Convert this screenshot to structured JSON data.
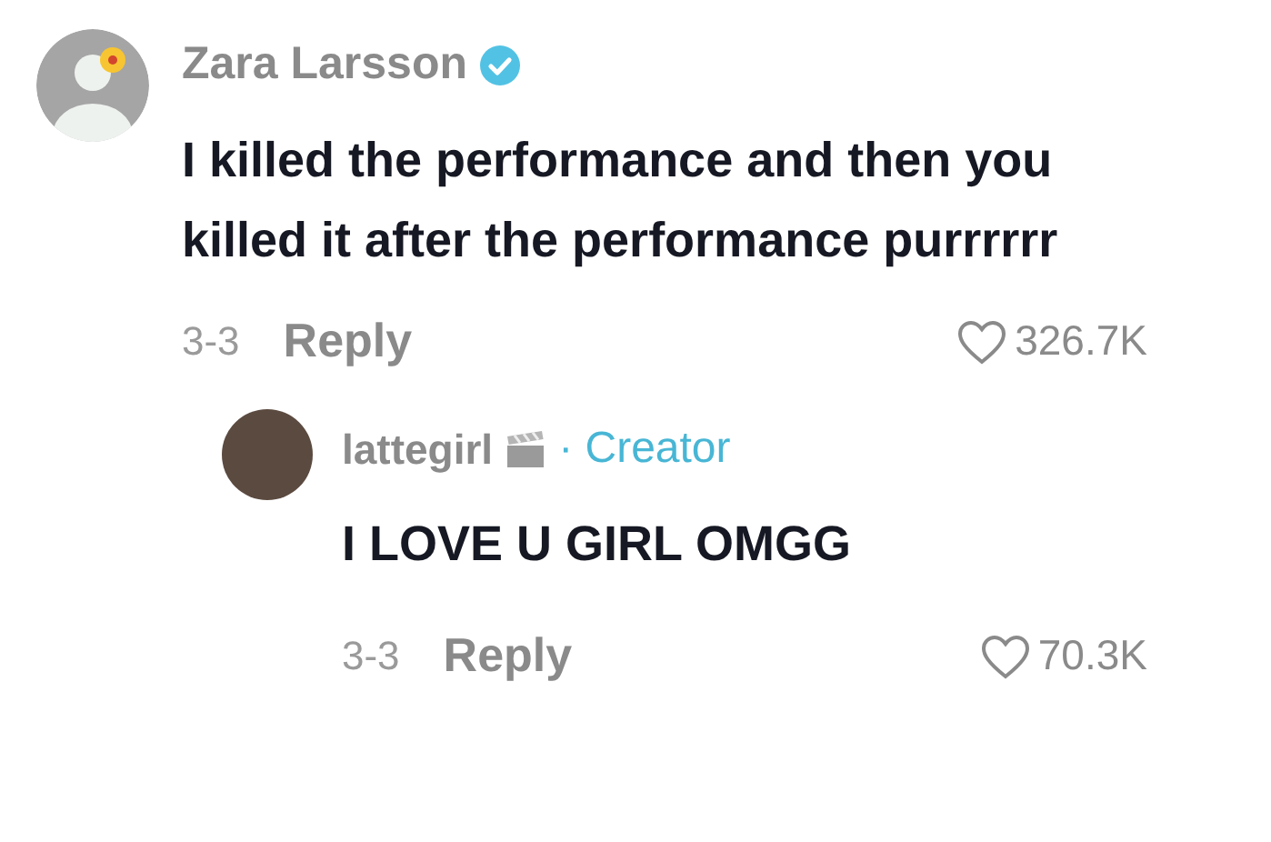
{
  "comments": [
    {
      "author": "Zara Larsson",
      "verified": true,
      "text": "I killed the performance and then you killed it after the performance purrrrrr",
      "date": "3-3",
      "reply_label": "Reply",
      "likes": "326.7K",
      "avatar": {
        "kind": "silhouette"
      },
      "replies": [
        {
          "author": "lattegirl",
          "verified": false,
          "badge": "· Creator",
          "text": "I LOVE U GIRL OMGG",
          "date": "3-3",
          "reply_label": "Reply",
          "likes": "70.3K",
          "avatar": {
            "kind": "photo"
          }
        }
      ]
    }
  ]
}
